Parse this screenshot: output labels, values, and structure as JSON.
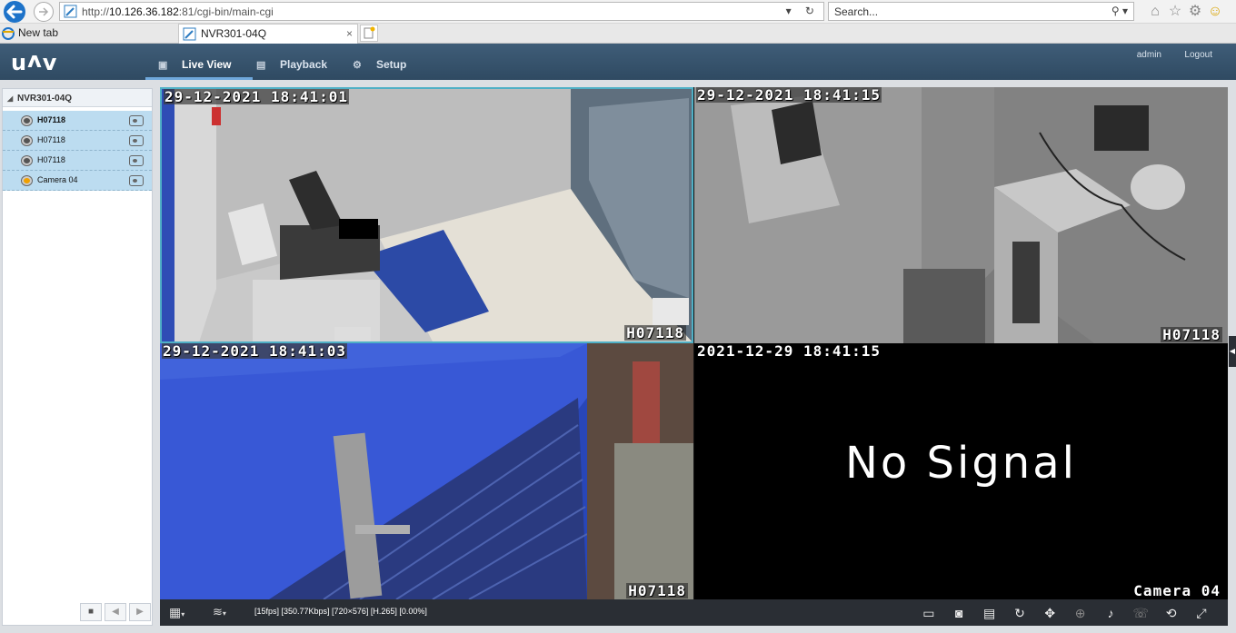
{
  "browser": {
    "url_prefix": "http://",
    "url_host": "10.126.36.182",
    "url_rest": ":81/cgi-bin/main-cgi",
    "search_placeholder": "Search...",
    "tabs": [
      {
        "label": "New tab"
      },
      {
        "label": "NVR301-04Q",
        "active": true
      }
    ]
  },
  "app": {
    "logo": "UNV",
    "nav": [
      {
        "label": "Live View",
        "icon": "monitor-icon",
        "active": true
      },
      {
        "label": "Playback",
        "icon": "film-icon"
      },
      {
        "label": "Setup",
        "icon": "gear-icon"
      }
    ],
    "user": "admin",
    "logout": "Logout"
  },
  "sidebar": {
    "device": "NVR301-04Q",
    "cameras": [
      {
        "label": "H07118",
        "status": "online",
        "active": true
      },
      {
        "label": "H07118",
        "status": "online"
      },
      {
        "label": "H07118",
        "status": "online"
      },
      {
        "label": "Camera 04",
        "status": "no-signal"
      }
    ]
  },
  "video": {
    "cells": [
      {
        "timestamp": "29-12-2021 18:41:01",
        "name": "H07118",
        "selected": true
      },
      {
        "timestamp": "29-12-2021 18:41:15",
        "name": "H07118"
      },
      {
        "timestamp": "29-12-2021 18:41:03",
        "name": "H07118"
      },
      {
        "timestamp": "2021-12-29 18:41:15",
        "name": "Camera 04",
        "message": "No Signal"
      }
    ]
  },
  "toolbar": {
    "status": "[15fps] [350.77Kbps] [720×576] [H.265] [0.00%]",
    "icons": [
      "stream-select-icon",
      "snapshot-icon",
      "record-icon",
      "ptz-icon",
      "focus-icon",
      "zoom-icon",
      "volume-icon",
      "talk-icon",
      "digital-zoom-icon",
      "fullscreen-icon"
    ]
  },
  "colors": {
    "header_bg": "#2f4a62",
    "selected_border": "#4fb0c6",
    "camera_row_bg": "#bcdcf0",
    "toolbar_bg": "#2a2e34"
  }
}
